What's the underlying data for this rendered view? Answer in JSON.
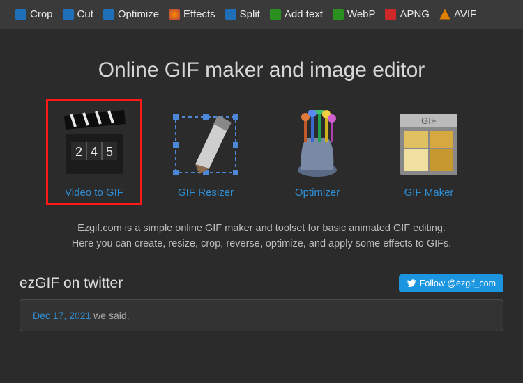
{
  "toolbar": {
    "items": [
      {
        "label": "Crop"
      },
      {
        "label": "Cut"
      },
      {
        "label": "Optimize"
      },
      {
        "label": "Effects"
      },
      {
        "label": "Split"
      },
      {
        "label": "Add text"
      },
      {
        "label": "WebP"
      },
      {
        "label": "APNG"
      },
      {
        "label": "AVIF"
      }
    ]
  },
  "hero": {
    "title": "Online GIF maker and image editor"
  },
  "tiles": [
    {
      "label": "Video to GIF",
      "highlighted": true
    },
    {
      "label": "GIF Resizer"
    },
    {
      "label": "Optimizer"
    },
    {
      "label": "GIF Maker"
    }
  ],
  "description": {
    "line1": "Ezgif.com is a simple online GIF maker and toolset for basic animated GIF editing.",
    "line2": "Here you can create, resize, crop, reverse, optimize, and apply some effects to GIFs."
  },
  "twitter": {
    "heading": "ezGIF on twitter",
    "follow_label": "Follow @ezgif_com",
    "tweet_date": "Dec 17, 2021",
    "tweet_prefix": " we said,"
  }
}
